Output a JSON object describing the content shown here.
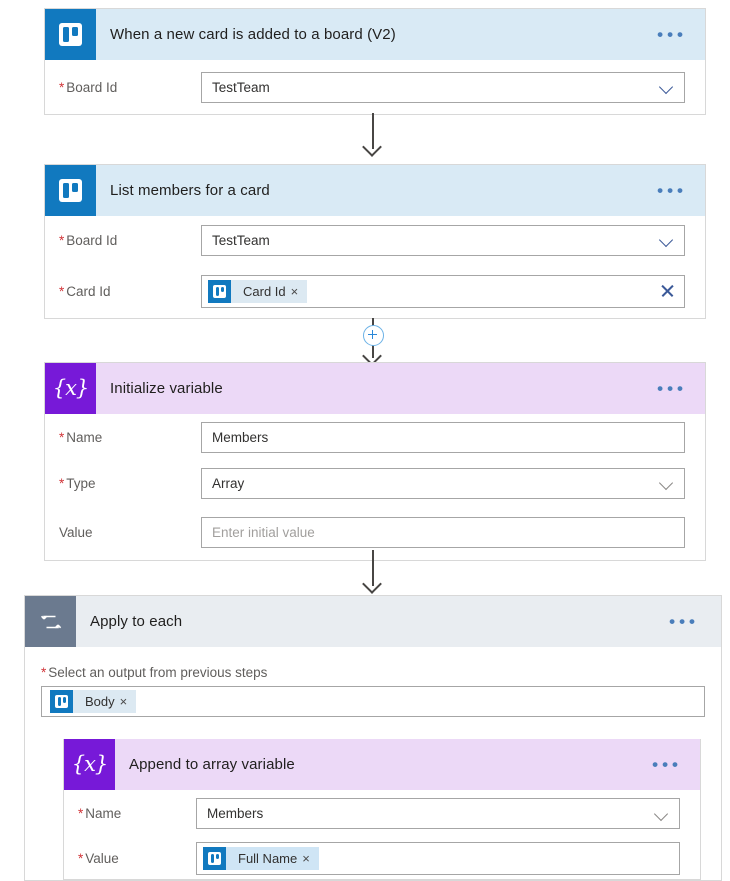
{
  "flow": {
    "steps": [
      {
        "id": "trigger",
        "title": "When a new card is added to a board (V2)",
        "icon": "trello-icon",
        "menu": "more-options",
        "fields": [
          {
            "label": "Board Id",
            "required": true,
            "value": "TestTeam",
            "control": "dropdown"
          }
        ]
      },
      {
        "id": "list-members",
        "title": "List members for a card",
        "icon": "trello-icon",
        "menu": "more-options",
        "fields": [
          {
            "label": "Board Id",
            "required": true,
            "value": "TestTeam",
            "control": "dropdown"
          },
          {
            "label": "Card Id",
            "required": true,
            "token": "Card Id",
            "control": "token-clear"
          }
        ]
      },
      {
        "id": "init-variable",
        "title": "Initialize variable",
        "icon": "variable-icon",
        "icon_glyph": "{x}",
        "menu": "more-options",
        "fields": [
          {
            "label": "Name",
            "required": true,
            "value": "Members",
            "control": "text"
          },
          {
            "label": "Type",
            "required": true,
            "value": "Array",
            "control": "dropdown-gray"
          },
          {
            "label": "Value",
            "required": false,
            "placeholder": "Enter initial value",
            "control": "text"
          }
        ]
      },
      {
        "id": "apply-to-each",
        "title": "Apply to each",
        "icon": "loop-icon",
        "menu": "more-options",
        "output_field": {
          "label": "Select an output from previous steps",
          "required": true,
          "token": "Body"
        },
        "nested": {
          "id": "append-to-array",
          "title": "Append to array variable",
          "icon": "variable-icon",
          "icon_glyph": "{x}",
          "menu": "more-options",
          "fields": [
            {
              "label": "Name",
              "required": true,
              "value": "Members",
              "control": "dropdown-gray"
            },
            {
              "label": "Value",
              "required": true,
              "token": "Full Name",
              "control": "token"
            }
          ]
        }
      }
    ],
    "connectors": [
      {
        "id": "connector-1",
        "has_plus": false
      },
      {
        "id": "connector-2",
        "has_plus": true
      },
      {
        "id": "connector-3",
        "has_plus": false
      }
    ],
    "token_remove_label": "×",
    "ellipsis_label": "•"
  },
  "colors": {
    "trello_blue": "#1179bf",
    "trello_header": "#d9eaf5",
    "variable_purple": "#7719d8",
    "variable_header": "#ecd9f7",
    "loop_gray": "#6b7a8f",
    "loop_header": "#e9edf1",
    "required_red": "#d13438",
    "accent_blue": "#2b88d8"
  }
}
